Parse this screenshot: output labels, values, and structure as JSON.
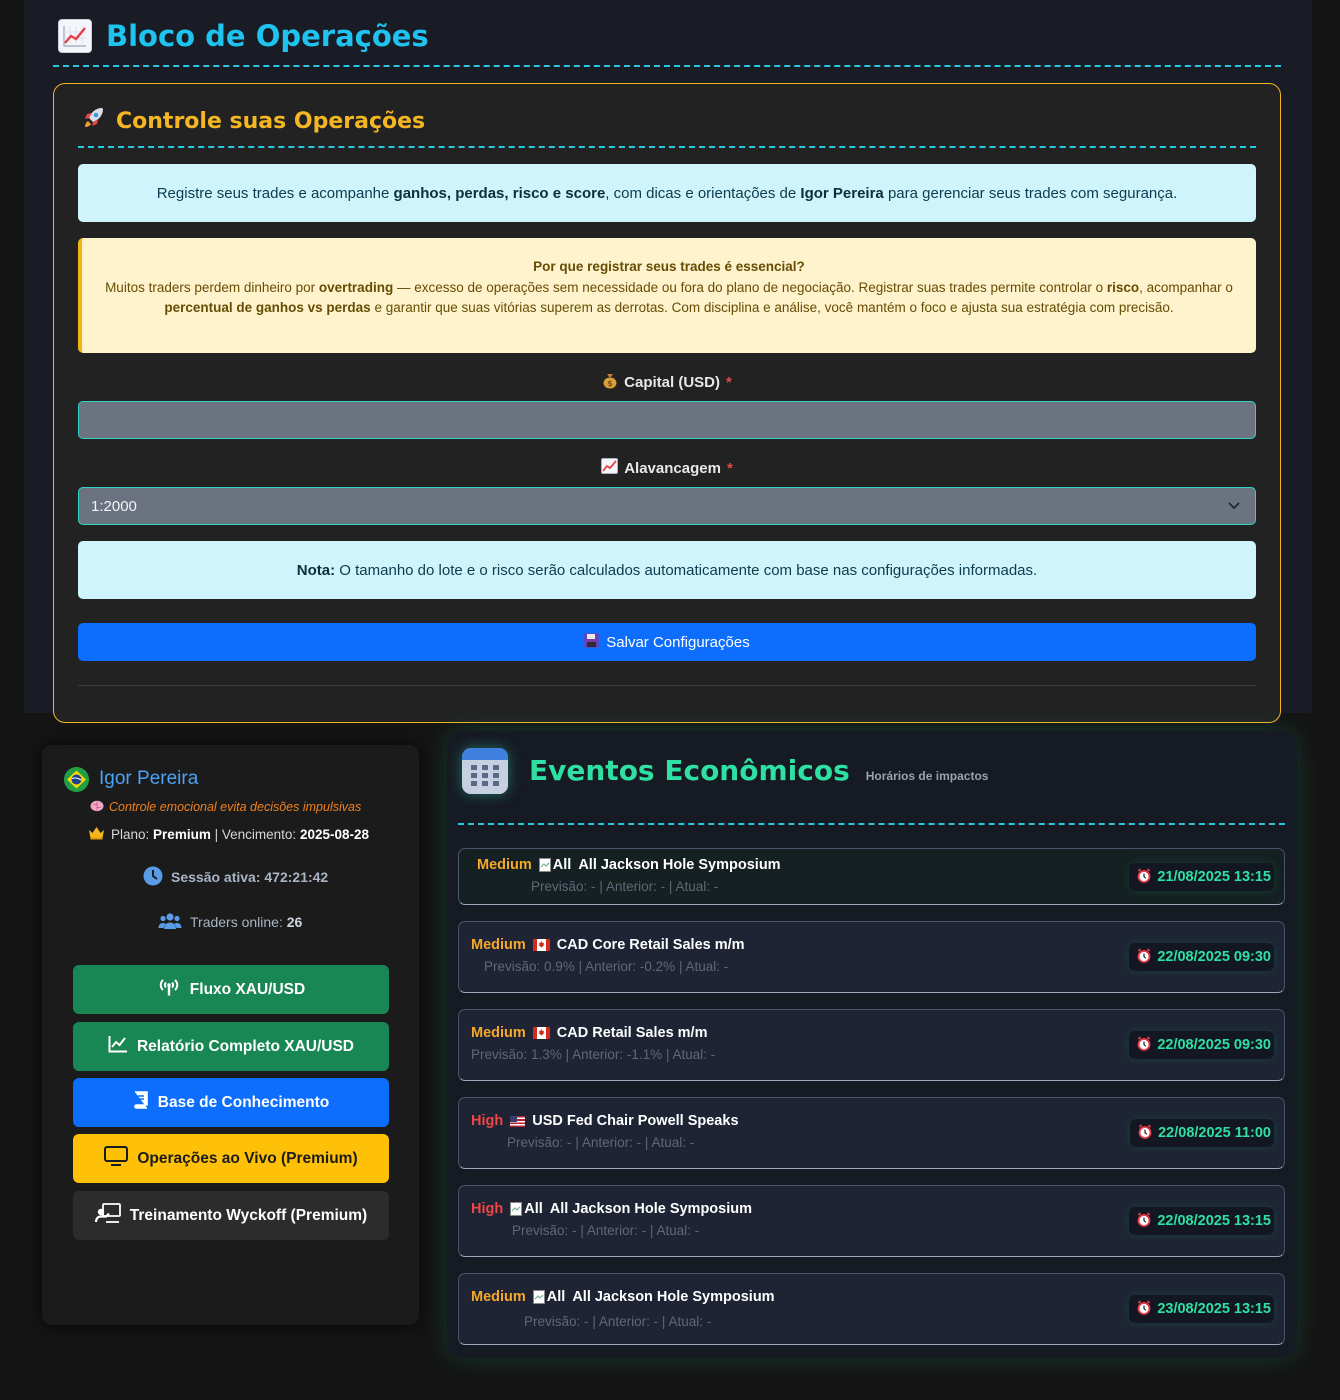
{
  "operations": {
    "page_title": "Bloco de Operações",
    "page_title_icon": "chart-increasing-icon",
    "card_title": "Controle suas Operações",
    "card_title_icon": "rocket-icon",
    "intro": {
      "pre": "Registre seus trades e acompanhe ",
      "bold1": "ganhos, perdas, risco e score",
      "mid": ", com dicas e orientações de ",
      "bold2": "Igor Pereira",
      "post": " para gerenciar seus trades com segurança."
    },
    "warning": {
      "title": "Por que registrar seus trades é essencial?",
      "t1": "Muitos traders perdem dinheiro por ",
      "b1": "overtrading",
      "t2": " — excesso de operações sem necessidade ou fora do plano de negociação. Registrar suas trades permite controlar o ",
      "b2": "risco",
      "t3": ", acompanhar o ",
      "b3": "percentual de ganhos vs perdas",
      "t4": " e garantir que suas vitórias superem as derrotas. Com disciplina e análise, você mantém o foco e ajusta sua estratégia com precisão."
    },
    "capital": {
      "label": "Capital (USD)",
      "required": "*",
      "value": "",
      "icon": "money-bag-icon"
    },
    "leverage": {
      "label": "Alavancagem",
      "required": "*",
      "value": "1:2000",
      "icon": "chart-increasing-icon"
    },
    "note": {
      "bold": "Nota:",
      "text": " O tamanho do lote e o risco serão calculados automaticamente com base nas configurações informadas."
    },
    "save_label": "Salvar Configurações",
    "save_icon": "floppy-disk-icon"
  },
  "profile": {
    "name": "Igor Pereira",
    "flag": "brazil-flag-icon",
    "tip": "Controle emocional evita decisões impulsivas",
    "plan_label": "Plano:",
    "plan_value": "Premium",
    "separator": "|",
    "expiry_label": "Vencimento:",
    "expiry_value": "2025-08-28",
    "session_label": "Sessão ativa:",
    "session_value": "472:21:42",
    "online_label": "Traders online:",
    "online_value": "26",
    "buttons": [
      {
        "label": "Fluxo XAU/USD",
        "icon": "broadcast-icon",
        "color": "#198754"
      },
      {
        "label": "Relatório Completo XAU/USD",
        "icon": "line-chart-icon",
        "color": "#198754"
      },
      {
        "label": "Base de Conhecimento",
        "icon": "book-icon",
        "color": "#0d6efd"
      },
      {
        "label": "Operações ao Vivo (Premium)",
        "icon": "tv-icon",
        "color": "#ffc107"
      },
      {
        "label": "Treinamento Wyckoff (Premium)",
        "icon": "teacher-icon",
        "color": "#2c2c2c"
      }
    ]
  },
  "events": {
    "title": "Eventos Econômicos",
    "subtitle": "Horários de impactos",
    "items": [
      {
        "impact": "Medium",
        "flag_alt": "All",
        "name": "All Jackson Hole Symposium",
        "previsao": "-",
        "anterior": "-",
        "atual": "-",
        "datetime": "21/08/2025 13:15"
      },
      {
        "impact": "Medium",
        "flag": "canada",
        "name": "CAD Core Retail Sales m/m",
        "previsao": "0.9%",
        "anterior": "-0.2%",
        "atual": "-",
        "datetime": "22/08/2025 09:30"
      },
      {
        "impact": "Medium",
        "flag": "canada",
        "name": "CAD Retail Sales m/m",
        "previsao": "1.3%",
        "anterior": "-1.1%",
        "atual": "-",
        "datetime": "22/08/2025 09:30"
      },
      {
        "impact": "High",
        "flag": "usa",
        "name": "USD Fed Chair Powell Speaks",
        "previsao": "-",
        "anterior": "-",
        "atual": "-",
        "datetime": "22/08/2025 11:00"
      },
      {
        "impact": "High",
        "flag_alt": "All",
        "name": "All Jackson Hole Symposium",
        "previsao": "-",
        "anterior": "-",
        "atual": "-",
        "datetime": "22/08/2025 13:15"
      },
      {
        "impact": "Medium",
        "flag_alt": "All",
        "name": "All Jackson Hole Symposium",
        "previsao": "-",
        "anterior": "-",
        "atual": "-",
        "datetime": "23/08/2025 13:15"
      }
    ],
    "labels": {
      "previsao": "Previsão:",
      "anterior": "Anterior:",
      "atual": "Atual:",
      "sep": "|"
    }
  }
}
